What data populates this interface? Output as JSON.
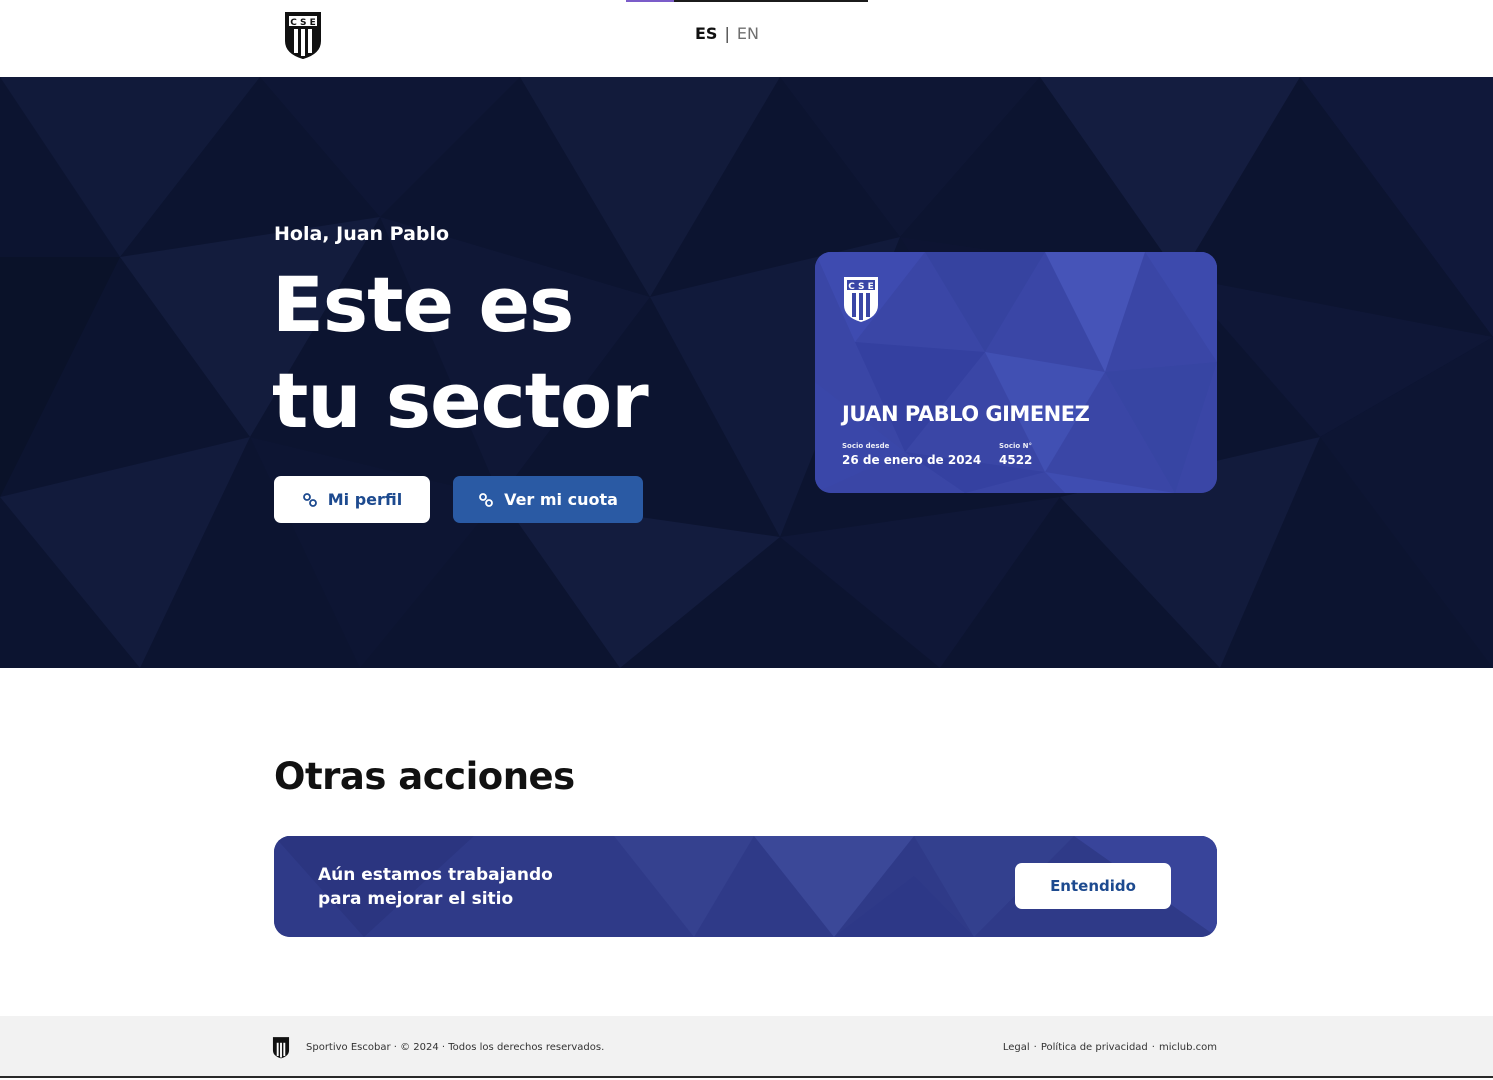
{
  "header": {
    "logo_text": "CSE",
    "lang_active": "ES",
    "lang_separator": "|",
    "lang_other": "EN"
  },
  "hero": {
    "greeting": "Hola, Juan Pablo",
    "title_line1": "Este es",
    "title_line2": "tu sector",
    "btn_profile": "Mi perfil",
    "btn_fee": "Ver mi cuota"
  },
  "card": {
    "name": "JUAN PABLO GIMENEZ",
    "since_label": "Socio desde",
    "since_value": "26 de enero de 2024",
    "number_label": "Socio N°",
    "number_value": "4522"
  },
  "other_actions": {
    "title": "Otras acciones",
    "banner_text_line1": "Aún estamos trabajando",
    "banner_text_line2": "para mejorar el sitio",
    "banner_button": "Entendido"
  },
  "footer": {
    "copyright": "Sportivo Escobar · © 2024 · Todos los derechos reservados.",
    "link_legal": "Legal",
    "link_privacy": "Política de privacidad",
    "link_site": "miclub.com",
    "separator": "·"
  },
  "colors": {
    "hero_bg": "#0d1531",
    "card_bg": "#3743a1",
    "primary_button": "#2a5aa4",
    "link_text": "#1d4a8f"
  }
}
